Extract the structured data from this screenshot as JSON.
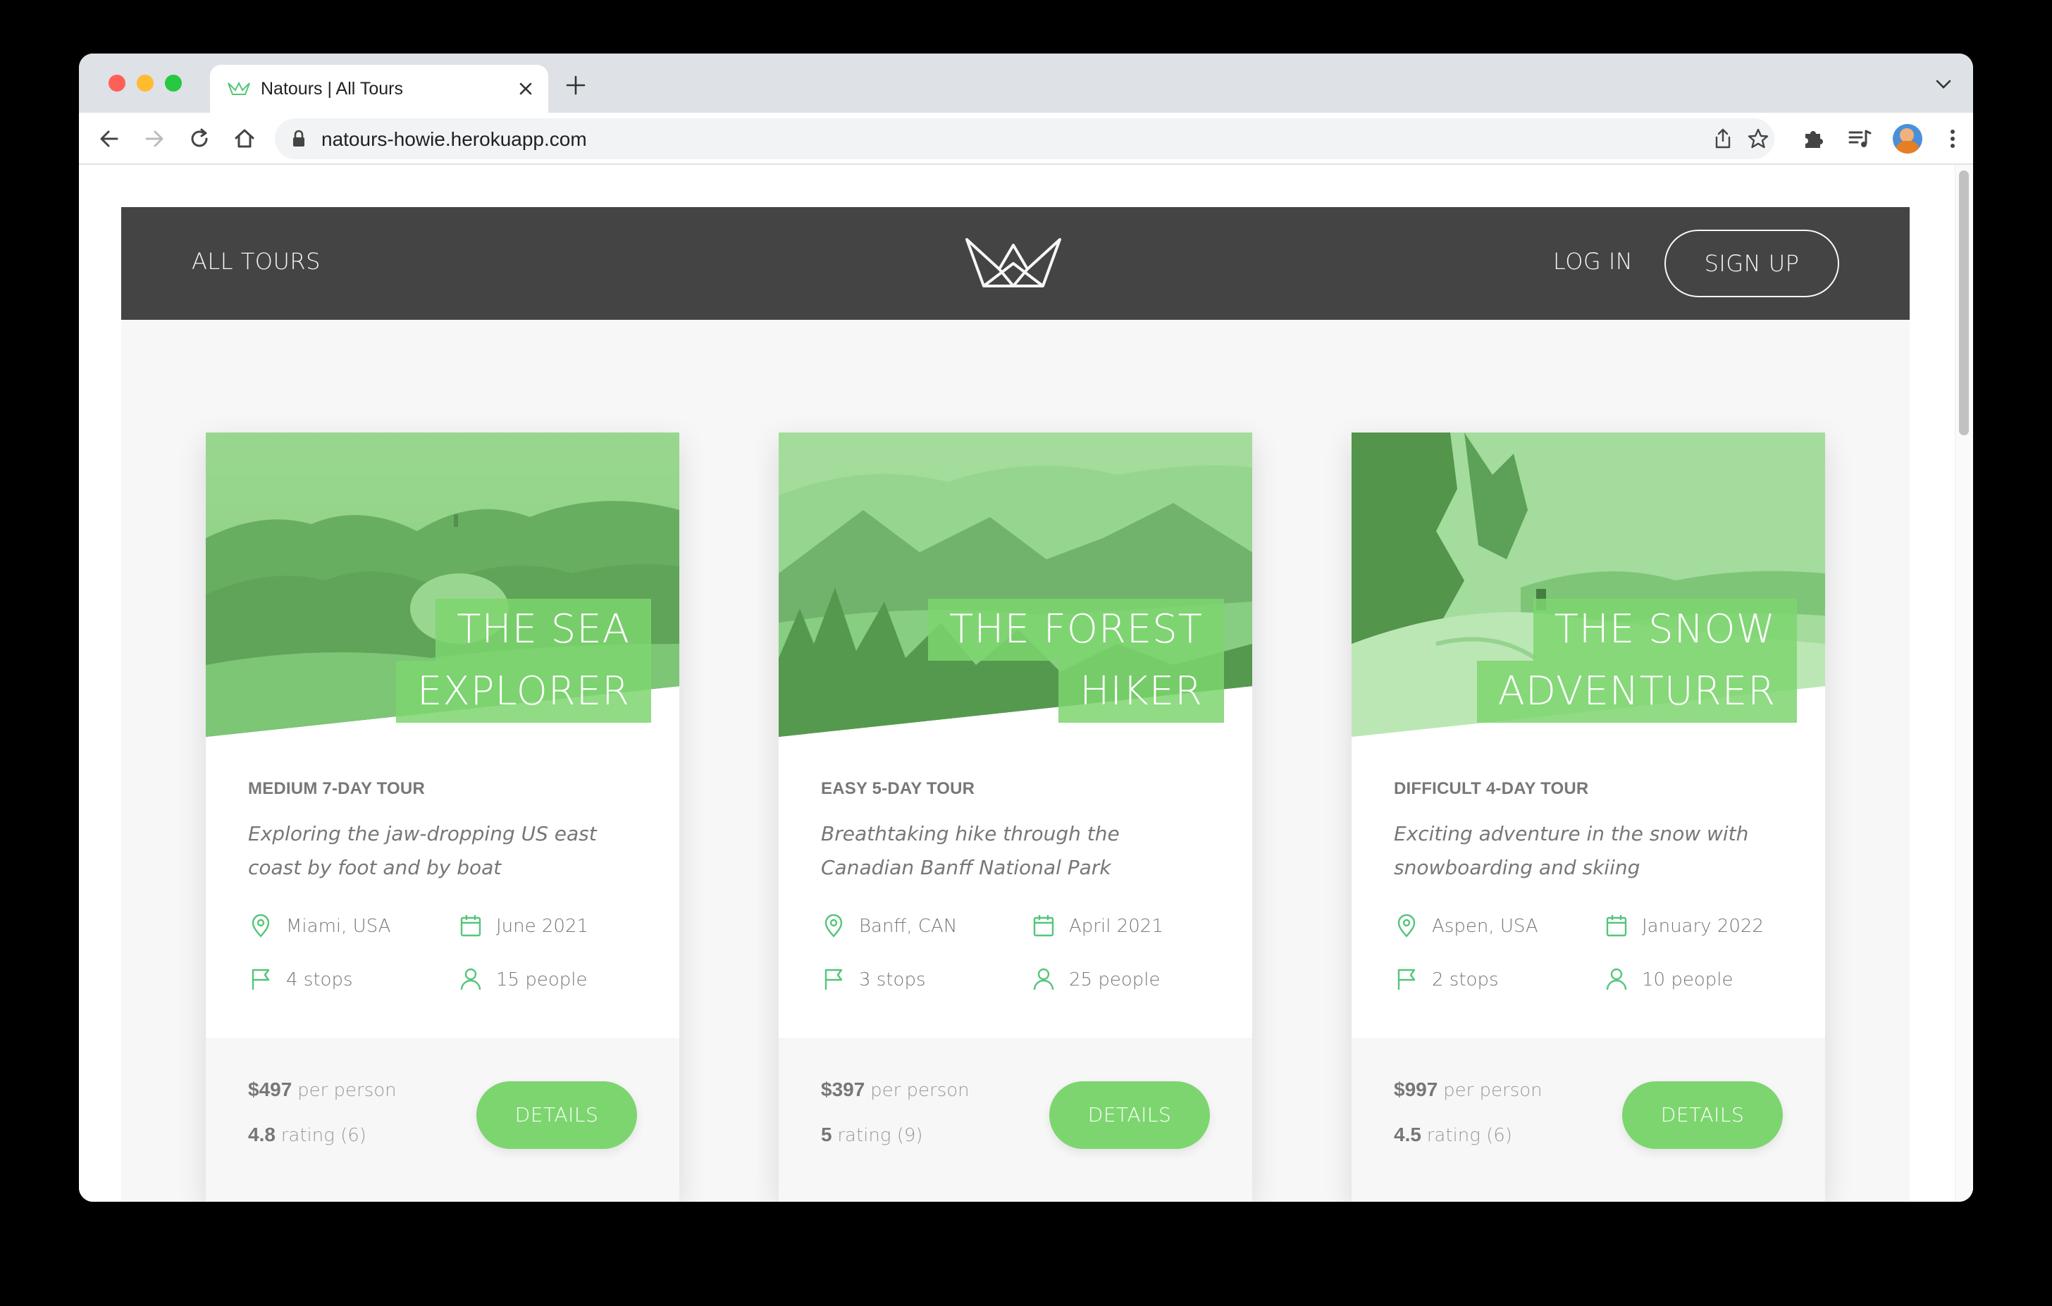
{
  "browser": {
    "tab_title": "Natours | All Tours",
    "url": "natours-howie.herokuapp.com"
  },
  "header": {
    "all_tours": "ALL TOURS",
    "login": "LOG IN",
    "signup": "SIGN UP"
  },
  "colors": {
    "accent": "#7dd56f",
    "header_bg": "#444444",
    "page_bg": "#f7f7f7"
  },
  "tours": [
    {
      "title_line1": "THE SEA",
      "title_line2": "EXPLORER",
      "subheading": "MEDIUM 7-DAY TOUR",
      "summary": "Exploring the jaw-dropping US east coast by foot and by boat",
      "location": "Miami, USA",
      "date": "June 2021",
      "stops": "4 stops",
      "people": "15 people",
      "price": "$497",
      "price_unit": "per person",
      "rating": "4.8",
      "rating_label": "rating (6)",
      "button": "DETAILS"
    },
    {
      "title_line1": "THE FOREST",
      "title_line2": "HIKER",
      "subheading": "EASY 5-DAY TOUR",
      "summary": "Breathtaking hike through the Canadian Banff National Park",
      "location": "Banff, CAN",
      "date": "April 2021",
      "stops": "3 stops",
      "people": "25 people",
      "price": "$397",
      "price_unit": "per person",
      "rating": "5",
      "rating_label": "rating (9)",
      "button": "DETAILS"
    },
    {
      "title_line1": "THE SNOW",
      "title_line2": "ADVENTURER",
      "subheading": "DIFFICULT 4-DAY TOUR",
      "summary": "Exciting adventure in the snow with snowboarding and skiing",
      "location": "Aspen, USA",
      "date": "January 2022",
      "stops": "2 stops",
      "people": "10 people",
      "price": "$997",
      "price_unit": "per person",
      "rating": "4.5",
      "rating_label": "rating (6)",
      "button": "DETAILS"
    }
  ]
}
